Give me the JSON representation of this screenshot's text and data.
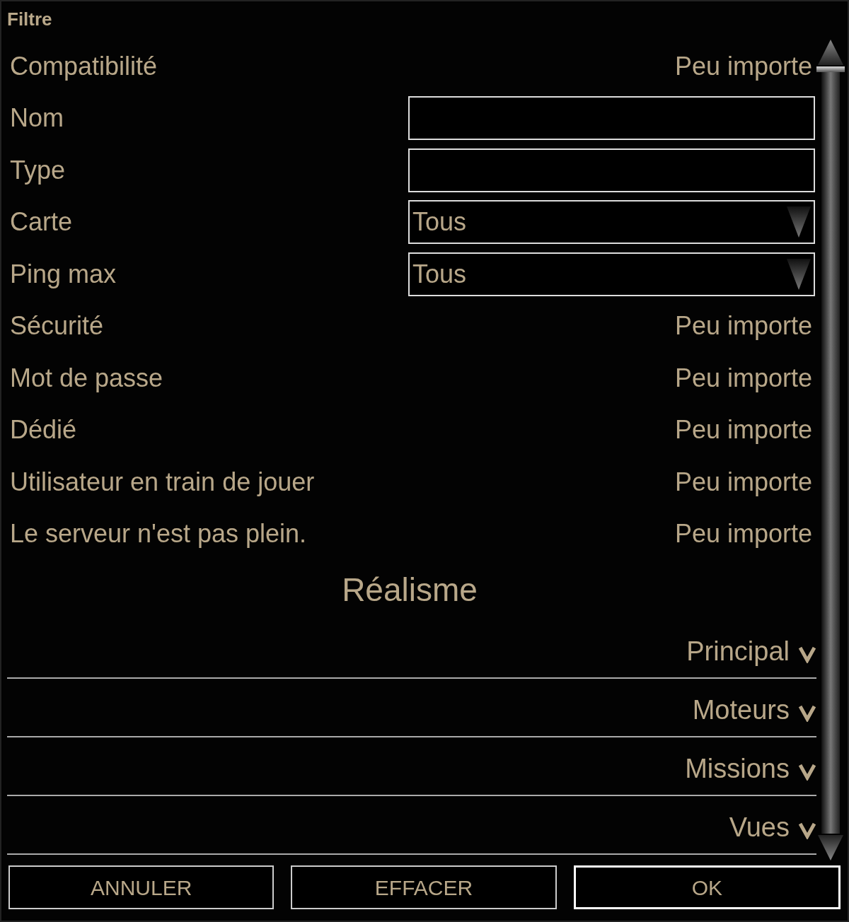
{
  "window": {
    "title": "Filtre"
  },
  "filters": [
    {
      "kind": "choice",
      "label": "Compatibilité",
      "value": "Peu importe"
    },
    {
      "kind": "text",
      "label": "Nom"
    },
    {
      "kind": "text",
      "label": "Type"
    },
    {
      "kind": "dropdown",
      "label": "Carte",
      "value": "Tous"
    },
    {
      "kind": "dropdown",
      "label": "Ping max",
      "value": "Tous"
    },
    {
      "kind": "choice",
      "label": "Sécurité",
      "value": "Peu importe"
    },
    {
      "kind": "choice",
      "label": "Mot de passe",
      "value": "Peu importe"
    },
    {
      "kind": "choice",
      "label": "Dédié",
      "value": "Peu importe"
    },
    {
      "kind": "choice",
      "label": "Utilisateur en train de jouer",
      "value": "Peu importe"
    },
    {
      "kind": "choice",
      "label": "Le serveur n'est pas plein.",
      "value": "Peu importe"
    }
  ],
  "section": {
    "title": "Réalisme",
    "groups": [
      {
        "label": "Principal",
        "expanded": false
      },
      {
        "label": "Moteurs",
        "expanded": false
      },
      {
        "label": "Missions",
        "expanded": false
      },
      {
        "label": "Vues",
        "expanded": false
      }
    ]
  },
  "buttons": [
    {
      "label": "ANNULER",
      "focused": false
    },
    {
      "label": "EFFACER",
      "focused": false
    },
    {
      "label": "OK",
      "focused": true
    }
  ]
}
